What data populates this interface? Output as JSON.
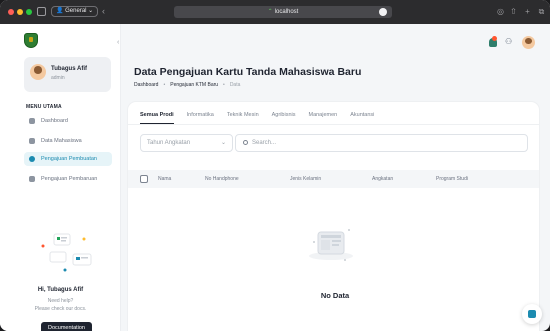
{
  "browser": {
    "profile_label": "General",
    "url": "localhost"
  },
  "sidebar": {
    "user_name": "Tubagus Afif",
    "user_role": "admin",
    "menu_title": "MENU UTAMA",
    "items": [
      {
        "label": "Dashboard",
        "active": false
      },
      {
        "label": "Data Mahasiswa",
        "active": false
      },
      {
        "label": "Pengajuan Pembuatan",
        "active": true
      },
      {
        "label": "Pengajuan Pembaruan",
        "active": false
      }
    ],
    "help": {
      "name": "Hi, Tubagus Afif",
      "line1": "Need help?",
      "line2": "Please check our docs.",
      "button": "Documentation"
    }
  },
  "page": {
    "title": "Data Pengajuan Kartu Tanda Mahasiswa Baru",
    "breadcrumb": [
      "Dashboard",
      "Pengajuan KTM Baru",
      "Data"
    ]
  },
  "tabs": [
    "Semua Prodi",
    "Informatika",
    "Teknik Mesin",
    "Agribisnis",
    "Manajemen",
    "Akuntansi"
  ],
  "filters": {
    "select_placeholder": "Tahun Angkatan",
    "search_placeholder": "Search..."
  },
  "table": {
    "columns": [
      "Nama",
      "No Handphone",
      "Jenis Kelamin",
      "Angkatan",
      "Program Studi"
    ],
    "empty_text": "No Data"
  },
  "colors": {
    "accent": "#1c8bb0",
    "dark": "#1f2430",
    "notification": "#ff5630"
  }
}
